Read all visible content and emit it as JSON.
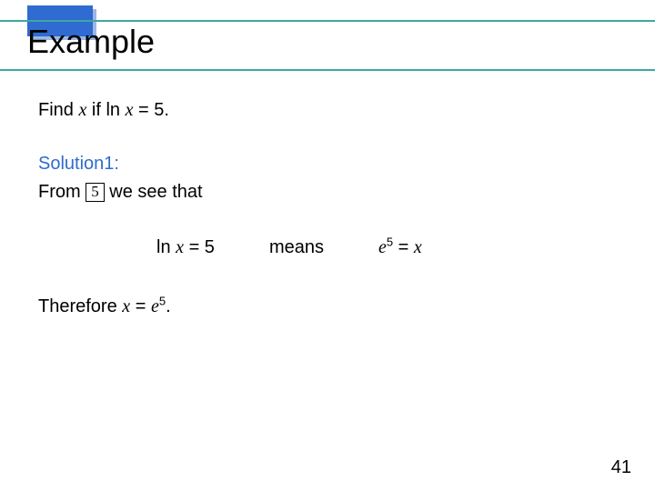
{
  "title": "Example",
  "problem": {
    "pre": "Find ",
    "var1": "x",
    "mid": " if ln ",
    "var2": "x",
    "post": " = 5."
  },
  "solution_label": "Solution1:",
  "from": {
    "pre": "From ",
    "ref": "5",
    "post": " we see that"
  },
  "eq": {
    "lhs_pre": "ln ",
    "lhs_var": "x",
    "lhs_post": " = 5",
    "connector": "means",
    "rhs_base": "e",
    "rhs_sup": "5",
    "rhs_mid": " = ",
    "rhs_var": "x"
  },
  "therefore": {
    "pre": "Therefore ",
    "var": "x",
    "mid": " = ",
    "base": "e",
    "sup": "5",
    "post": "."
  },
  "page_number": "41"
}
